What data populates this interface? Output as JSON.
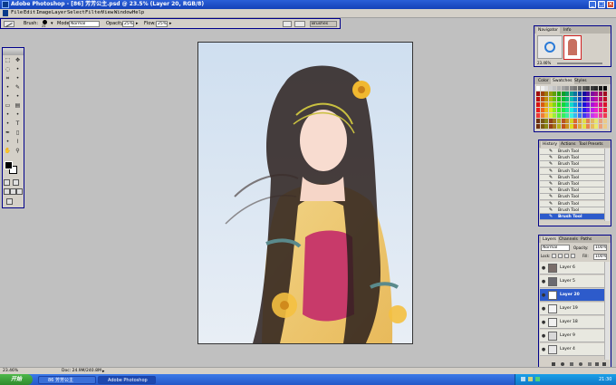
{
  "window": {
    "title": "Adobe Photoshop - [86] 芳芳公主.psd @ 23.5% (Layer 20, RGB/8)"
  },
  "menu": [
    "File",
    "Edit",
    "Image",
    "Layer",
    "Select",
    "Filter",
    "View",
    "Window",
    "Help"
  ],
  "options": {
    "brush_label": "Brush:",
    "brush_size": "25",
    "mode_label": "Mode:",
    "mode_value": "Normal",
    "opacity_label": "Opacity:",
    "opacity_value": "25%",
    "flow_label": "Flow:",
    "flow_value": "25%",
    "palette_well_label": "Brushes"
  },
  "navigator": {
    "tabs": [
      "Navigator",
      "Info"
    ],
    "zoom": "23.46%"
  },
  "swatches": {
    "tabs": [
      "Color",
      "Swatches",
      "Styles"
    ]
  },
  "history": {
    "tabs": [
      "History",
      "Actions",
      "Tool Presets"
    ],
    "items": [
      "Brush Tool",
      "Brush Tool",
      "Brush Tool",
      "Brush Tool",
      "Brush Tool",
      "Brush Tool",
      "Brush Tool",
      "Brush Tool",
      "Brush Tool",
      "Brush Tool",
      "Brush Tool"
    ],
    "selected_index": 10
  },
  "layers": {
    "tabs": [
      "Layers",
      "Channels",
      "Paths"
    ],
    "blend_mode": "Normal",
    "opacity_label": "Opacity:",
    "opacity_value": "100%",
    "lock_label": "Lock:",
    "fill_label": "Fill:",
    "fill_value": "100%",
    "items": [
      {
        "name": "Layer 6",
        "color": "#7a6e6a"
      },
      {
        "name": "Layer 5",
        "color": "#6a6a70"
      },
      {
        "name": "Layer 20",
        "color": "#ffffff",
        "selected": true
      },
      {
        "name": "Layer 19",
        "color": "#f4f4f4"
      },
      {
        "name": "Layer 18",
        "color": "#f0f0f0"
      },
      {
        "name": "Layer 9",
        "color": "#d8d8d8"
      },
      {
        "name": "Layer 4",
        "color": "#e8e8e8"
      }
    ]
  },
  "status": {
    "zoom": "23.46%",
    "doc": "Doc: 24.9M/240.8M"
  },
  "taskbar": {
    "start_label": "开始",
    "items": [
      "86 芳芳公主",
      "Adobe Photoshop"
    ],
    "time": "21:30"
  }
}
